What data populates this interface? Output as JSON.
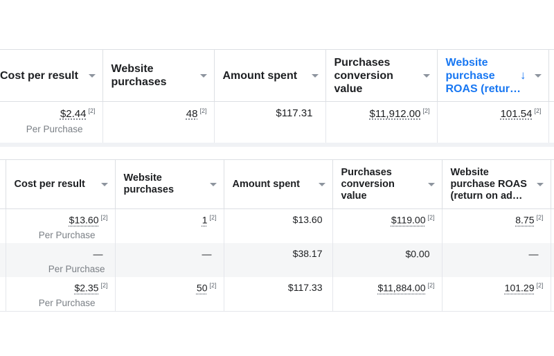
{
  "table1": {
    "headers": [
      {
        "label": "Cost per result"
      },
      {
        "label": "Website purchases"
      },
      {
        "label": "Amount spent"
      },
      {
        "label": "Purchases conversion value"
      },
      {
        "label": "Website purchase ROAS (retur…"
      }
    ],
    "row": {
      "cost": "$2.44",
      "cost_fn": "[2]",
      "cost_sub": "Per Purchase",
      "purchases": "48",
      "purchases_fn": "[2]",
      "spent": "$117.31",
      "value": "$11,912.00",
      "value_fn": "[2]",
      "roas": "101.54",
      "roas_fn": "[2]"
    }
  },
  "table2": {
    "headers": [
      {
        "label": "Cost per result"
      },
      {
        "label": "Website purchases"
      },
      {
        "label": "Amount spent"
      },
      {
        "label": "Purchases conversion value"
      },
      {
        "label": "Website purchase ROAS (return on ad…"
      }
    ],
    "rows": [
      {
        "cost": "$13.60",
        "cost_fn": "[2]",
        "cost_sub": "Per Purchase",
        "purchases": "1",
        "purchases_fn": "[2]",
        "spent": "$13.60",
        "value": "$119.00",
        "value_fn": "[2]",
        "roas": "8.75",
        "roas_fn": "[2]"
      },
      {
        "cost": "—",
        "cost_fn": "",
        "cost_sub": "Per Purchase",
        "purchases": "—",
        "purchases_fn": "",
        "spent": "$38.17",
        "value": "$0.00",
        "value_fn": "",
        "roas": "—",
        "roas_fn": ""
      },
      {
        "cost": "$2.35",
        "cost_fn": "[2]",
        "cost_sub": "Per Purchase",
        "purchases": "50",
        "purchases_fn": "[2]",
        "spent": "$117.33",
        "value": "$11,884.00",
        "value_fn": "[2]",
        "roas": "101.29",
        "roas_fn": "[2]"
      }
    ]
  },
  "icons": {
    "sort": "arrow-down-icon",
    "menu": "caret-down-icon"
  },
  "colors": {
    "accent": "#1877f2",
    "border": "#dcdfe3",
    "shade": "#f5f6f7",
    "muted": "#7a7f85"
  }
}
